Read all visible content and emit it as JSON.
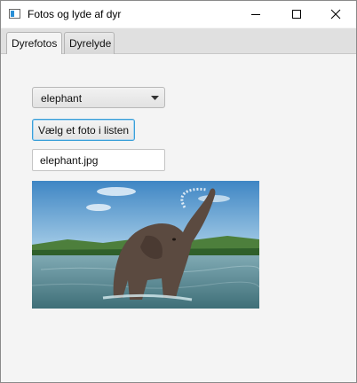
{
  "window": {
    "title": "Fotos og lyde af dyr",
    "icon": "app-window-icon",
    "controls": [
      "minimize-icon",
      "maximize-icon",
      "close-icon"
    ]
  },
  "tabs": [
    {
      "label": "Dyrefotos",
      "selected": true
    },
    {
      "label": "Dyrelyde",
      "selected": false
    }
  ],
  "main": {
    "animal_select": {
      "value": "elephant"
    },
    "choose_button": {
      "label": "Vælg et foto i listen"
    },
    "filename_field": {
      "value": "elephant.jpg"
    },
    "photo": {
      "subject": "elephant spraying water in a river"
    }
  },
  "colors": {
    "focus_blue": "#3a9fd8",
    "window_bg": "#f4f4f4"
  }
}
